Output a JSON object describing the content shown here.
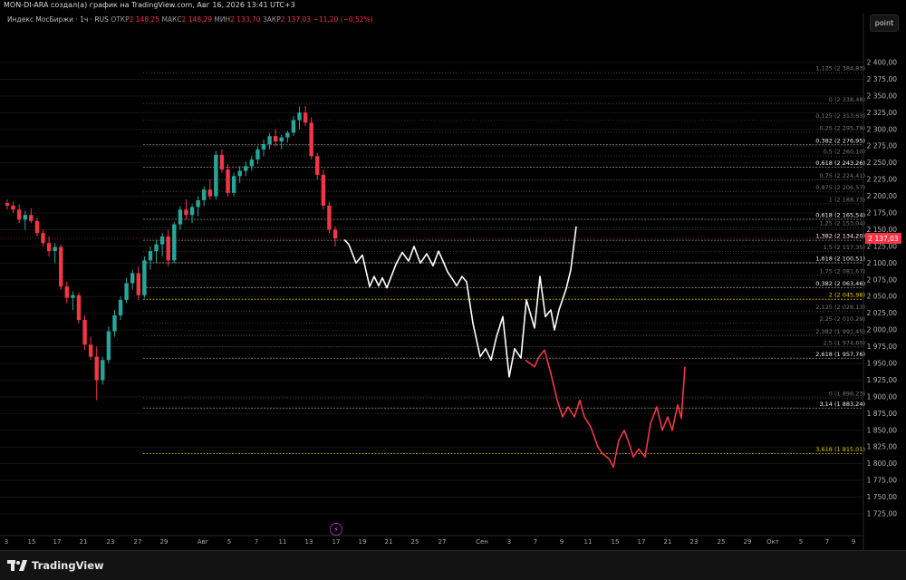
{
  "header": {
    "title": "MON-DI-ARA создал(а) график на TradingView.com, Авг 16, 2026 13:41 UTC+3"
  },
  "legend": {
    "symbol": "Индекс МосБиржи · 1ч · RUS",
    "open_label": "ОТКР",
    "open_value": "2 148,25",
    "high_label": "МАКС",
    "high_value": "2 148,29",
    "low_label": "МИН",
    "low_value": "2 133,70",
    "close_label": "ЗАКР",
    "close_value": "2 137,03",
    "change": "−11,20 (−0,52%)"
  },
  "toolbar": {
    "point_label": "point"
  },
  "footer": {
    "logo_text": "TradingView"
  },
  "colors": {
    "up": "#26a69a",
    "down": "#f23645",
    "projection_main": "#ffffff",
    "projection_alt": "#f23645",
    "price_tag": "#f23645"
  },
  "chart_data": {
    "type": "line",
    "symbol": "Индекс МосБиржи",
    "timeframe": "1ч",
    "y_axis": {
      "min": 1700,
      "max": 2425,
      "ticks": [
        2400,
        2375,
        2350,
        2325,
        2300,
        2275,
        2250,
        2225,
        2200,
        2175,
        2150,
        2125,
        2100,
        2075,
        2050,
        2025,
        2000,
        1975,
        1950,
        1925,
        1900,
        1875,
        1850,
        1825,
        1800,
        1775,
        1750,
        1725
      ],
      "tick_labels": [
        "2 400,00",
        "2 375,00",
        "2 350,00",
        "2 325,00",
        "2 300,00",
        "2 275,00",
        "2 250,00",
        "2 225,00",
        "2 200,00",
        "2 175,00",
        "2 150,00",
        "2 125,00",
        "2 100,00",
        "2 075,00",
        "2 050,00",
        "2 025,00",
        "2 000,00",
        "1 975,00",
        "1 950,00",
        "1 925,00",
        "1 900,00",
        "1 875,00",
        "1 850,00",
        "1 825,00",
        "1 800,00",
        "1 775,00",
        "1 750,00",
        "1 725,00"
      ]
    },
    "x_axis": {
      "labels": [
        "3",
        "15",
        "17",
        "21",
        "23",
        "27",
        "29",
        "Авг",
        "5",
        "7",
        "11",
        "13",
        "17",
        "19",
        "21",
        "25",
        "27",
        "Сен",
        "3",
        "7",
        "9",
        "11",
        "15",
        "17",
        "21",
        "23",
        "25",
        "29",
        "Окт",
        "5",
        "7",
        "9"
      ]
    },
    "last_price_label": "2 137,03",
    "last_price": 2137.03,
    "fib_levels": [
      {
        "label": "1,125 (2 384,83)",
        "value": 2384.83,
        "emph": false
      },
      {
        "label": "0 (2 338,48)",
        "value": 2338.48,
        "emph": false
      },
      {
        "label": "0,125 (2 313,63)",
        "value": 2313.63,
        "emph": false
      },
      {
        "label": "0,25 (2 295,79)",
        "value": 2295.79,
        "emph": false
      },
      {
        "label": "0,382 (2 276,95)",
        "value": 2276.95,
        "emph": true
      },
      {
        "label": "0,5 (2 260,10)",
        "value": 2260.1,
        "emph": false
      },
      {
        "label": "0,618 (2 243,26)",
        "value": 2243.26,
        "emph": true
      },
      {
        "label": "0,75 (2 224,41)",
        "value": 2224.41,
        "emph": false
      },
      {
        "label": "0,875 (2 206,57)",
        "value": 2206.57,
        "emph": false
      },
      {
        "label": "1 (2 188,73)",
        "value": 2188.73,
        "emph": false
      },
      {
        "label": "0,618 (2 165,54)",
        "value": 2165.54,
        "emph": true
      },
      {
        "label": "1,25 (2 153,04)",
        "value": 2153.04,
        "emph": false
      },
      {
        "label": "1,382 (2 134,20)",
        "value": 2134.2,
        "emph": true
      },
      {
        "label": "1,5 (2 117,35)",
        "value": 2117.35,
        "emph": false
      },
      {
        "label": "1,618 (2 100,51)",
        "value": 2100.51,
        "emph": true
      },
      {
        "label": "1,75 (2 081,67)",
        "value": 2081.67,
        "emph": false
      },
      {
        "label": "0,382 (2 063,46)",
        "value": 2063.46,
        "emph": true
      },
      {
        "label": "2 (2 045,98)",
        "value": 2045.98,
        "emph": "gold"
      },
      {
        "label": "2,125 (2 028,13)",
        "value": 2028.13,
        "emph": false
      },
      {
        "label": "2,25 (2 010,29)",
        "value": 2010.29,
        "emph": false
      },
      {
        "label": "2,382 (1 991,45)",
        "value": 1991.45,
        "emph": false
      },
      {
        "label": "2,5 (1 974,60)",
        "value": 1974.6,
        "emph": false
      },
      {
        "label": "2,618 (1 957,76)",
        "value": 1957.76,
        "emph": true
      },
      {
        "label": "0 (1 898,23)",
        "value": 1898.23,
        "emph": false
      },
      {
        "label": "3,14 (1 883,24)",
        "value": 1883.24,
        "emph": true
      },
      {
        "label": "3,618 (1 815,01)",
        "value": 1815.01,
        "emph": "gold"
      }
    ],
    "candles": [
      [
        2190,
        2195,
        2180,
        2186
      ],
      [
        2186,
        2192,
        2175,
        2180
      ],
      [
        2180,
        2188,
        2160,
        2165
      ],
      [
        2165,
        2178,
        2150,
        2172
      ],
      [
        2172,
        2182,
        2160,
        2163
      ],
      [
        2163,
        2168,
        2140,
        2145
      ],
      [
        2145,
        2150,
        2125,
        2130
      ],
      [
        2130,
        2140,
        2110,
        2118
      ],
      [
        2118,
        2130,
        2100,
        2124
      ],
      [
        2124,
        2128,
        2060,
        2065
      ],
      [
        2065,
        2072,
        2040,
        2048
      ],
      [
        2048,
        2058,
        2030,
        2052
      ],
      [
        2052,
        2056,
        2010,
        2015
      ],
      [
        2015,
        2022,
        1970,
        1978
      ],
      [
        1978,
        1990,
        1955,
        1960
      ],
      [
        1960,
        1975,
        1895,
        1925
      ],
      [
        1925,
        1960,
        1918,
        1955
      ],
      [
        1955,
        2005,
        1950,
        1998
      ],
      [
        1998,
        2030,
        1990,
        2022
      ],
      [
        2022,
        2050,
        2015,
        2045
      ],
      [
        2045,
        2078,
        2040,
        2070
      ],
      [
        2070,
        2090,
        2060,
        2085
      ],
      [
        2085,
        2095,
        2045,
        2052
      ],
      [
        2052,
        2110,
        2048,
        2104
      ],
      [
        2104,
        2125,
        2090,
        2118
      ],
      [
        2118,
        2135,
        2100,
        2128
      ],
      [
        2128,
        2145,
        2110,
        2140
      ],
      [
        2140,
        2150,
        2095,
        2104
      ],
      [
        2104,
        2162,
        2100,
        2158
      ],
      [
        2158,
        2185,
        2150,
        2180
      ],
      [
        2180,
        2195,
        2165,
        2172
      ],
      [
        2172,
        2188,
        2160,
        2184
      ],
      [
        2184,
        2200,
        2170,
        2194
      ],
      [
        2194,
        2215,
        2185,
        2210
      ],
      [
        2210,
        2225,
        2195,
        2200
      ],
      [
        2200,
        2268,
        2195,
        2262
      ],
      [
        2262,
        2270,
        2235,
        2240
      ],
      [
        2240,
        2248,
        2200,
        2205
      ],
      [
        2205,
        2235,
        2200,
        2230
      ],
      [
        2230,
        2245,
        2220,
        2238
      ],
      [
        2238,
        2252,
        2230,
        2245
      ],
      [
        2245,
        2260,
        2238,
        2255
      ],
      [
        2255,
        2275,
        2248,
        2270
      ],
      [
        2270,
        2285,
        2260,
        2278
      ],
      [
        2278,
        2295,
        2270,
        2290
      ],
      [
        2290,
        2300,
        2275,
        2282
      ],
      [
        2282,
        2292,
        2270,
        2288
      ],
      [
        2288,
        2298,
        2280,
        2295
      ],
      [
        2295,
        2320,
        2290,
        2314
      ],
      [
        2314,
        2334,
        2300,
        2325
      ],
      [
        2325,
        2335,
        2305,
        2310
      ],
      [
        2310,
        2318,
        2255,
        2260
      ],
      [
        2260,
        2265,
        2225,
        2232
      ],
      [
        2232,
        2240,
        2180,
        2186
      ],
      [
        2186,
        2192,
        2145,
        2150
      ],
      [
        2150,
        2155,
        2125,
        2137
      ]
    ],
    "projection_main": [
      [
        380,
        2135
      ],
      [
        385,
        2128
      ],
      [
        393,
        2100
      ],
      [
        400,
        2112
      ],
      [
        408,
        2065
      ],
      [
        413,
        2080
      ],
      [
        418,
        2066
      ],
      [
        422,
        2078
      ],
      [
        427,
        2063
      ],
      [
        437,
        2098
      ],
      [
        444,
        2116
      ],
      [
        451,
        2103
      ],
      [
        457,
        2125
      ],
      [
        464,
        2100
      ],
      [
        471,
        2114
      ],
      [
        478,
        2096
      ],
      [
        484,
        2118
      ],
      [
        489,
        2103
      ],
      [
        494,
        2087
      ],
      [
        500,
        2075
      ],
      [
        504,
        2066
      ],
      [
        510,
        2080
      ],
      [
        515,
        2072
      ],
      [
        522,
        2010
      ],
      [
        530,
        1960
      ],
      [
        536,
        1972
      ],
      [
        542,
        1955
      ],
      [
        548,
        1990
      ],
      [
        555,
        2020
      ],
      [
        562,
        1930
      ],
      [
        568,
        1972
      ],
      [
        575,
        1958
      ],
      [
        581,
        2045
      ],
      [
        590,
        2003
      ],
      [
        596,
        2080
      ],
      [
        602,
        2020
      ],
      [
        608,
        2030
      ],
      [
        612,
        2000
      ],
      [
        617,
        2030
      ],
      [
        625,
        2062
      ],
      [
        630,
        2090
      ],
      [
        636,
        2155
      ]
    ],
    "projection_alt": [
      [
        580,
        1955
      ],
      [
        585,
        1950
      ],
      [
        590,
        1945
      ],
      [
        595,
        1960
      ],
      [
        601,
        1970
      ],
      [
        608,
        1935
      ],
      [
        615,
        1895
      ],
      [
        621,
        1870
      ],
      [
        627,
        1885
      ],
      [
        634,
        1870
      ],
      [
        640,
        1895
      ],
      [
        645,
        1870
      ],
      [
        652,
        1855
      ],
      [
        660,
        1825
      ],
      [
        665,
        1815
      ],
      [
        672,
        1808
      ],
      [
        677,
        1795
      ],
      [
        683,
        1835
      ],
      [
        689,
        1850
      ],
      [
        694,
        1832
      ],
      [
        699,
        1810
      ],
      [
        705,
        1822
      ],
      [
        712,
        1810
      ],
      [
        718,
        1860
      ],
      [
        725,
        1885
      ],
      [
        731,
        1850
      ],
      [
        737,
        1870
      ],
      [
        742,
        1850
      ],
      [
        748,
        1888
      ],
      [
        752,
        1868
      ],
      [
        756,
        1945
      ]
    ]
  }
}
